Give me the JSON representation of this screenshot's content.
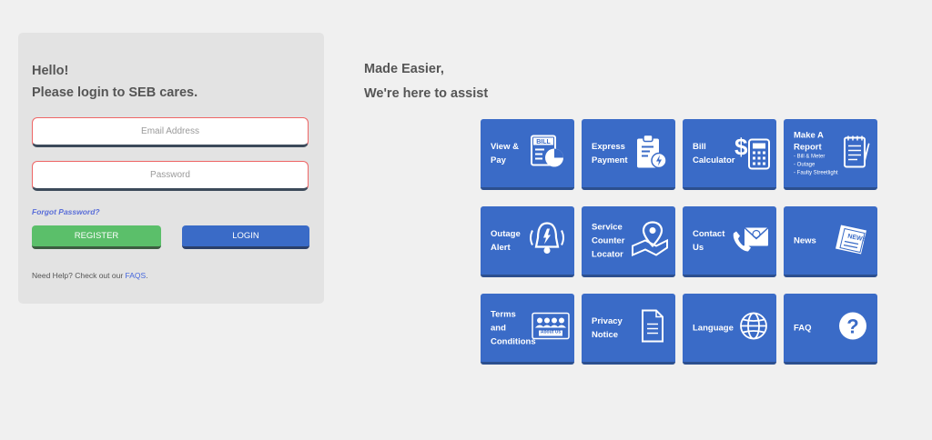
{
  "login": {
    "greeting_line1": "Hello!",
    "greeting_line2": "Please login to SEB cares.",
    "email_placeholder": "Email Address",
    "password_placeholder": "Password",
    "forgot_password": "Forgot Password?",
    "register_label": "REGISTER",
    "login_label": "LOGIN",
    "help_text": "Need Help? Check out our ",
    "faqs_link": "FAQS",
    "help_suffix": "."
  },
  "assist": {
    "line1": "Made Easier,",
    "line2": "We're here to assist"
  },
  "tiles": [
    {
      "label_lines": [
        "View &",
        "Pay"
      ],
      "icon": "bill-pie-icon"
    },
    {
      "label_lines": [
        "Express",
        "Payment"
      ],
      "icon": "clipboard-lightning-icon"
    },
    {
      "label_lines": [
        "Bill",
        "Calculator"
      ],
      "icon": "calculator-dollar-icon"
    },
    {
      "label_lines": [
        "Make A",
        "Report"
      ],
      "sub_lines": [
        "- Bill & Meter",
        "- Outage",
        "- Faulty Streetlight"
      ],
      "icon": "report-notepad-icon"
    },
    {
      "label_lines": [
        "Outage",
        "Alert"
      ],
      "icon": "alert-bell-icon"
    },
    {
      "label_lines": [
        "Service",
        "Counter",
        "Locator"
      ],
      "icon": "map-pin-icon"
    },
    {
      "label_lines": [
        "Contact",
        "Us"
      ],
      "icon": "phone-envelope-icon"
    },
    {
      "label_lines": [
        "News"
      ],
      "icon": "newspaper-icon"
    },
    {
      "label_lines": [
        "Terms",
        "and",
        "Conditions"
      ],
      "icon": "about-us-people-icon",
      "icon_text": "About Us"
    },
    {
      "label_lines": [
        "Privacy",
        "Notice"
      ],
      "icon": "document-icon"
    },
    {
      "label_lines": [
        "Language"
      ],
      "icon": "globe-icon"
    },
    {
      "label_lines": [
        "FAQ"
      ],
      "icon": "question-circle-icon"
    }
  ],
  "colors": {
    "tile_blue": "#3a6bc7",
    "register_green": "#5bbf6a",
    "page_background": "#f0f0f0",
    "card_background": "#e3e3e3"
  }
}
